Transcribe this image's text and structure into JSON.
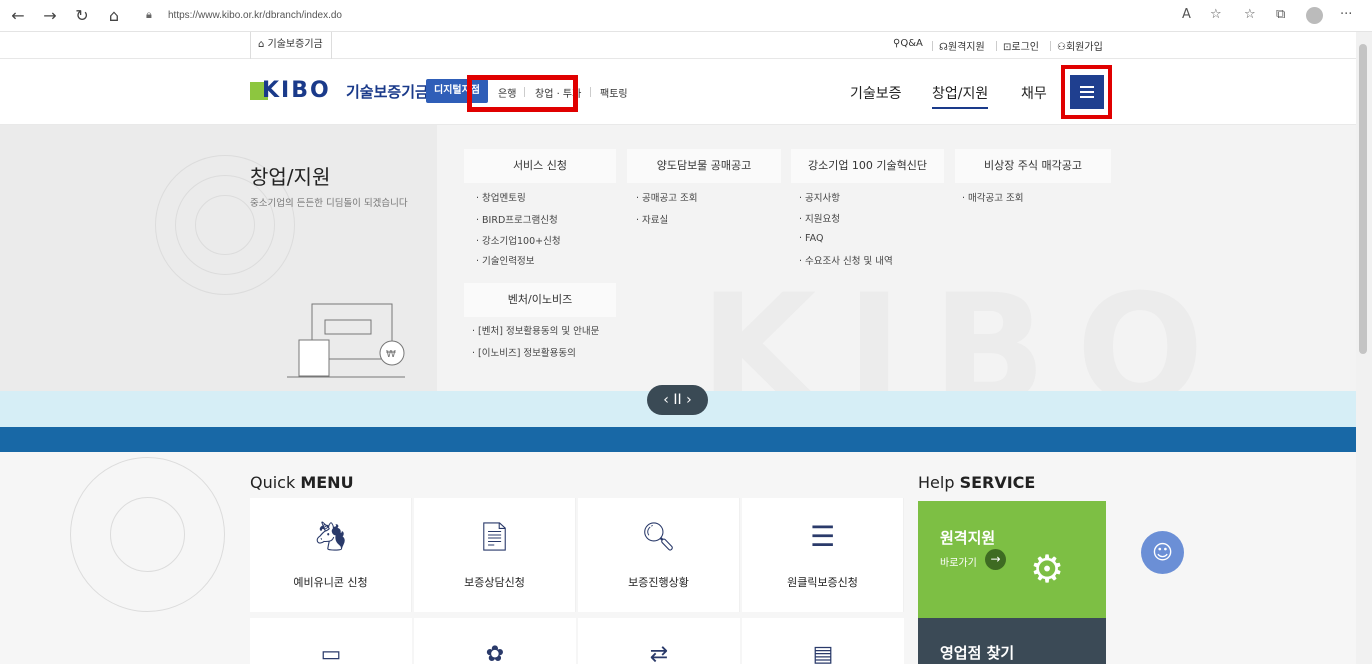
{
  "browser": {
    "url": "https://www.kibo.or.kr/dbranch/index.do",
    "icons": [
      "back-icon",
      "forward-icon",
      "refresh-icon",
      "home-icon",
      "lock-icon",
      "read-aloud-icon",
      "favorite-add-icon",
      "favorites-icon",
      "collections-icon",
      "profile-icon",
      "more-icon"
    ]
  },
  "util": {
    "home_label": "기술보증기금",
    "links": [
      "Q&A",
      "원격지원",
      "로그인",
      "회원가입"
    ]
  },
  "header": {
    "logo_text": "KIBO",
    "logo_name": "기술보증기금",
    "badge": "디지털지점",
    "sub_links": [
      "은행",
      "창업 · 투자",
      "팩토링"
    ],
    "nav": [
      "기술보증",
      "창업/지원",
      "채무"
    ],
    "active_nav": "창업/지원"
  },
  "mega": {
    "title": "창업/지원",
    "desc": "중소기업의 든든한 디딤돌이 되겠습니다",
    "columns": [
      {
        "head": "서비스 신청",
        "items": [
          "· 창업멘토링",
          "· BIRD프로그램신청",
          "· 강소기업100+신청",
          "· 기술인력정보"
        ]
      },
      {
        "head": "양도담보물 공매공고",
        "items": [
          "· 공매공고 조회",
          "· 자료실"
        ]
      },
      {
        "head": "강소기업 100 기술혁신단",
        "items": [
          "· 공지사항",
          "· 지원요청",
          "· FAQ",
          "· 수요조사 신청 및 내역"
        ]
      },
      {
        "head": "비상장 주식 매각공고",
        "items": [
          "· 매각공고 조회"
        ]
      },
      {
        "head": "벤처/이노비즈",
        "items": [
          "· [벤처] 정보활용동의 및 안내문",
          "· [이노비즈] 정보활용동의"
        ]
      }
    ]
  },
  "slider": {
    "prev": "‹",
    "pause": "II",
    "next": "›"
  },
  "quick_menu": {
    "title_light": "Quick ",
    "title_bold": "MENU",
    "items": [
      {
        "label": "예비유니콘 신청",
        "icon": "unicorn-icon"
      },
      {
        "label": "보증상담신청",
        "icon": "document-icon"
      },
      {
        "label": "보증진행상황",
        "icon": "search-document-icon"
      },
      {
        "label": "원클릭보증신청",
        "icon": "click-document-icon"
      }
    ]
  },
  "help": {
    "title_light": "Help ",
    "title_bold": "SERVICE",
    "remote_title": "원격지원",
    "remote_go": "바로가기",
    "branch_title": "영업점 찾기"
  },
  "colors": {
    "brand_blue": "#1a3a8a",
    "brand_green": "#8dc63f",
    "highlight_red": "#e00000",
    "help_green": "#7dbf44"
  }
}
